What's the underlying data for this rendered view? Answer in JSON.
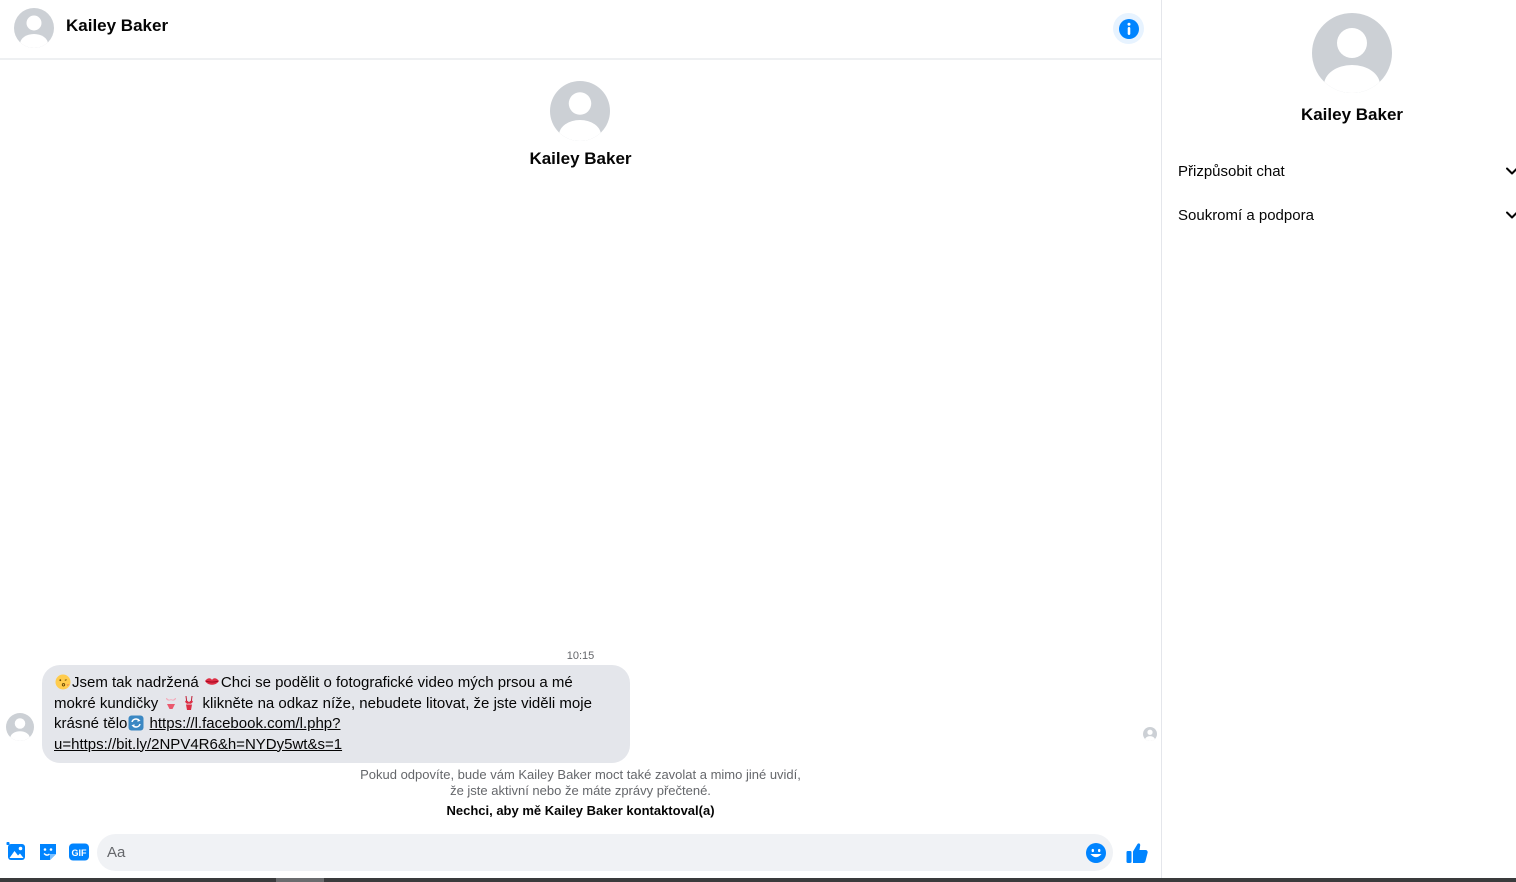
{
  "header": {
    "name": "Kailey Baker"
  },
  "intro": {
    "name": "Kailey Baker"
  },
  "message": {
    "time": "10:15",
    "part1": "Jsem tak nadržená ",
    "part2": "Chci se podělit o fotografické video mých prsou a mé mokré kundičky ",
    "part3": " klikněte na odkaz níže, nebudete litovat, že jste viděli moje krásné tělo",
    "link": "https://l.facebook.com/l.php?u=https://bit.ly/2NPV4R6&h=NYDy5wt&s=1"
  },
  "notice": {
    "line1": "Pokud odpovíte, bude vám Kailey Baker moct také zavolat a mimo jiné uvidí,",
    "line2": "že jste aktivní nebo že máte zprávy přečtené.",
    "block": "Nechci, aby mě Kailey Baker kontaktoval(a)"
  },
  "composer": {
    "placeholder": "Aa",
    "value": "",
    "gif_label": "GIF"
  },
  "sidebar": {
    "name": "Kailey Baker",
    "sections": [
      "Přizpůsobit chat",
      "Soukromí a podpora"
    ]
  },
  "icons": {
    "info": "info-icon",
    "photo": "photo-icon",
    "sticker": "sticker-icon",
    "gif": "gif-icon",
    "emoji": "emoji-icon",
    "like": "thumbs-up-icon",
    "chevron": "chevron-down-icon"
  },
  "colors": {
    "accent": "#0084ff",
    "bubble": "#e4e6eb",
    "secondary_text": "#65676b"
  }
}
